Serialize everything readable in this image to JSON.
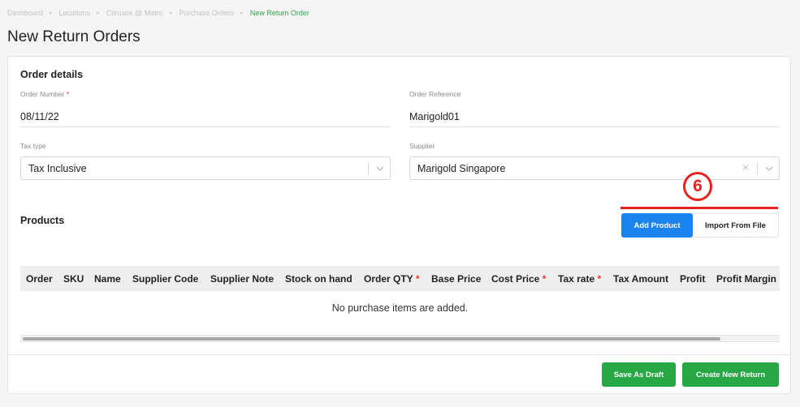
{
  "breadcrumb": {
    "items": [
      "Dashboard",
      "Locations",
      "Citrusox @ Metro",
      "Purchase Orders"
    ],
    "active": "New Return Order"
  },
  "page": {
    "title": "New Return Orders"
  },
  "order_details": {
    "title": "Order details",
    "order_number": {
      "label": "Order Number",
      "value": "08/11/22"
    },
    "order_reference": {
      "label": "Order Reference",
      "value": "Marigold01"
    },
    "tax_type": {
      "label": "Tax type",
      "value": "Tax Inclusive"
    },
    "supplier": {
      "label": "Supplier",
      "value": "Marigold Singapore"
    }
  },
  "annotation": {
    "number": "6",
    "color": "#e5241f"
  },
  "products": {
    "title": "Products",
    "add_product_label": "Add Product",
    "import_label": "Import From File",
    "columns": [
      "Order",
      "SKU",
      "Name",
      "Supplier Code",
      "Supplier Note",
      "Stock on hand",
      "Order QTY",
      "Base Price",
      "Cost Price",
      "Tax rate",
      "Tax Amount",
      "Profit",
      "Profit Margin"
    ],
    "empty_message": "No purchase items are added."
  },
  "footer": {
    "save_draft_label": "Save As Draft",
    "create_label": "Create New Return"
  },
  "colors": {
    "primary": "#1a83f0",
    "success": "#28a745",
    "breadcrumb_active": "#2ea44f",
    "required": "#e53935"
  }
}
